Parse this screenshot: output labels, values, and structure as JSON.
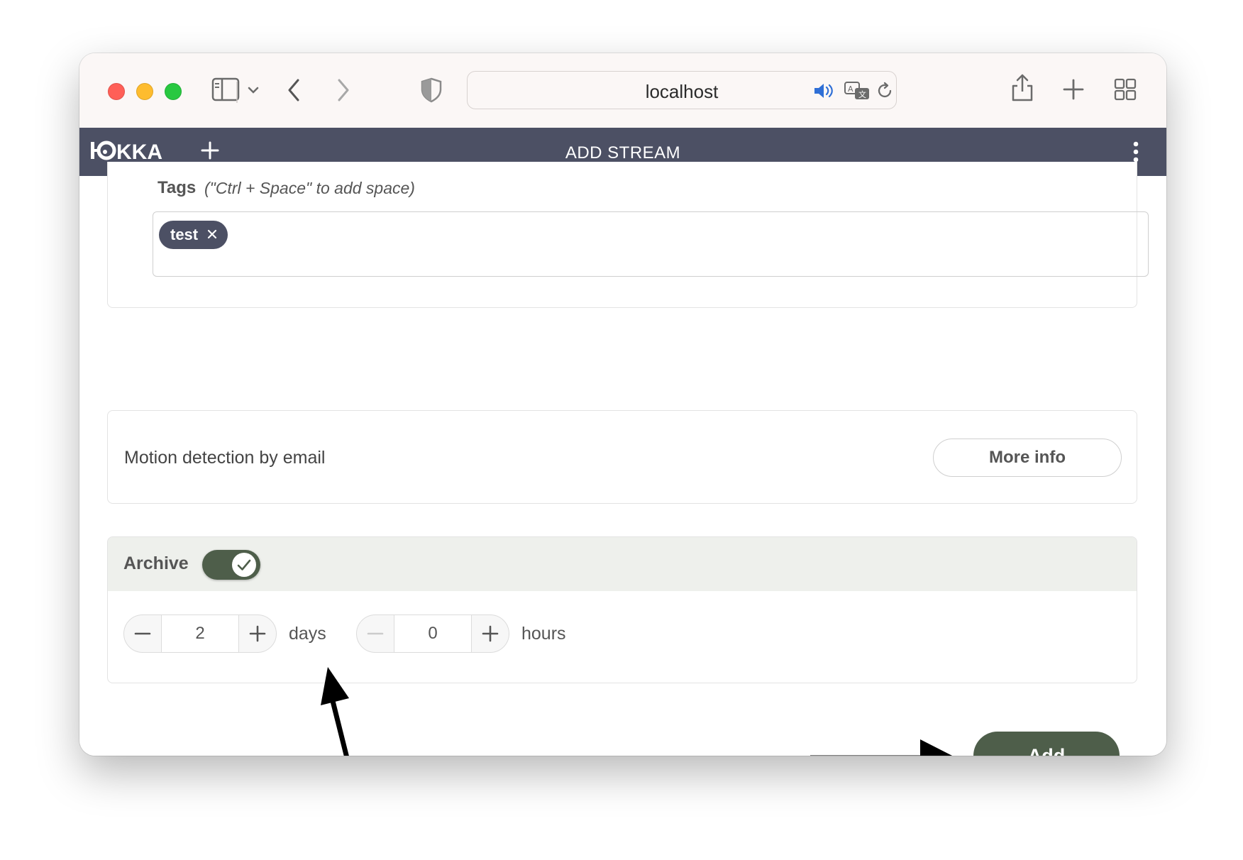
{
  "browser": {
    "address": "localhost"
  },
  "header": {
    "logo_text": "HOKKA",
    "title": "ADD STREAM"
  },
  "tags": {
    "label": "Tags",
    "hint": "(\"Ctrl + Space\" to add space)",
    "chips": [
      "test"
    ]
  },
  "motion": {
    "label": "Motion detection by email",
    "button_label": "More info"
  },
  "archive": {
    "label": "Archive",
    "enabled": true,
    "days_value": "2",
    "days_unit": "days",
    "hours_value": "0",
    "hours_unit": "hours"
  },
  "actions": {
    "add_label": "Add"
  },
  "colors": {
    "header_bg": "#4c5064",
    "accent_green": "#4e5e4a",
    "chip_bg": "#4c5064"
  },
  "icons": [
    "sidebar-icon",
    "chevron-down-icon",
    "back-icon",
    "forward-icon",
    "shield-icon",
    "speaker-icon",
    "translate-icon",
    "reload-icon",
    "share-icon",
    "new-tab-icon",
    "tabs-overview-icon",
    "plus-icon",
    "kebab-menu-icon",
    "close-icon",
    "check-icon",
    "minus-icon",
    "arrow-icon"
  ]
}
